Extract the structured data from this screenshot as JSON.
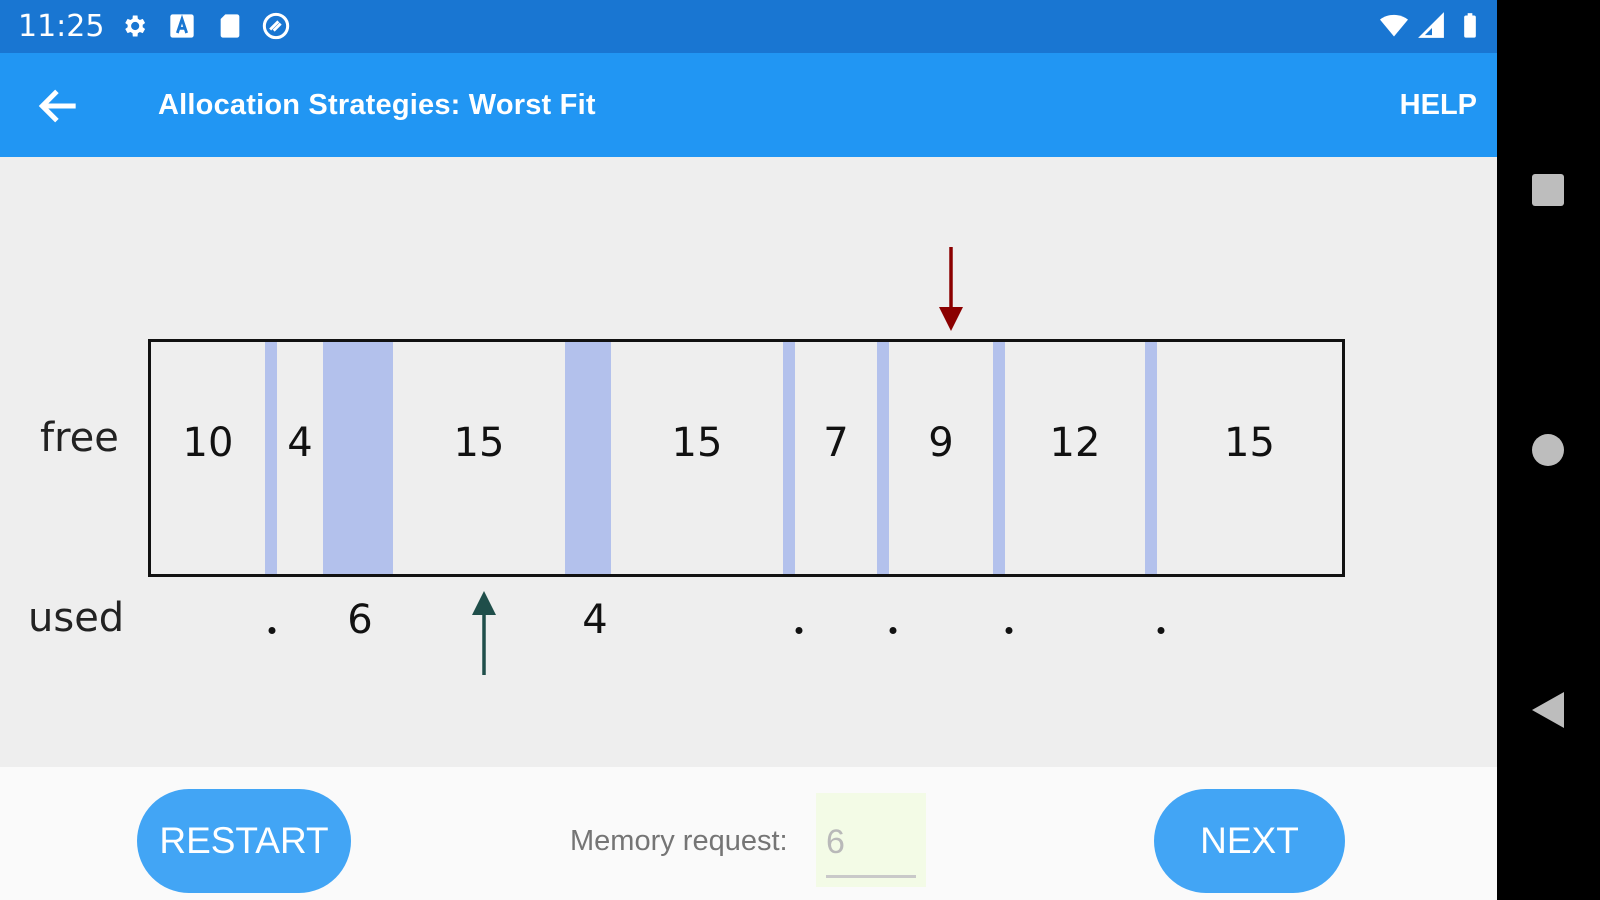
{
  "status_bar": {
    "time": "11:25",
    "icons": [
      "gear-icon",
      "a-badge-icon",
      "sd-card-icon",
      "at-sign-icon",
      "wifi-icon",
      "signal-icon",
      "battery-icon"
    ]
  },
  "app_bar": {
    "title": "Allocation Strategies: Worst Fit",
    "help_label": "HELP",
    "back_icon": "arrow-left-icon"
  },
  "visualizer": {
    "free_label": "free",
    "used_label": "used",
    "blocks": [
      {
        "kind": "free",
        "value": "10"
      },
      {
        "kind": "used",
        "value": "•"
      },
      {
        "kind": "free",
        "value": "4"
      },
      {
        "kind": "used",
        "value": "6"
      },
      {
        "kind": "free",
        "value": "15"
      },
      {
        "kind": "used",
        "value": "4"
      },
      {
        "kind": "free",
        "value": "15"
      },
      {
        "kind": "used",
        "value": "•"
      },
      {
        "kind": "free",
        "value": "7"
      },
      {
        "kind": "used",
        "value": "•"
      },
      {
        "kind": "free",
        "value": "9"
      },
      {
        "kind": "used",
        "value": "•"
      },
      {
        "kind": "free",
        "value": "12"
      },
      {
        "kind": "used",
        "value": "•"
      },
      {
        "kind": "free",
        "value": "15"
      }
    ],
    "colors": {
      "used": "#b3c1ec",
      "down_arrow": "#8b0000",
      "up_arrow": "#1f4e4a"
    }
  },
  "controls": {
    "restart_label": "RESTART",
    "next_label": "NEXT",
    "request_label": "Memory request:",
    "request_value": "6"
  },
  "colors": {
    "status_bar": "#1976d2",
    "app_bar": "#2196f3",
    "button": "#42a5f5"
  }
}
